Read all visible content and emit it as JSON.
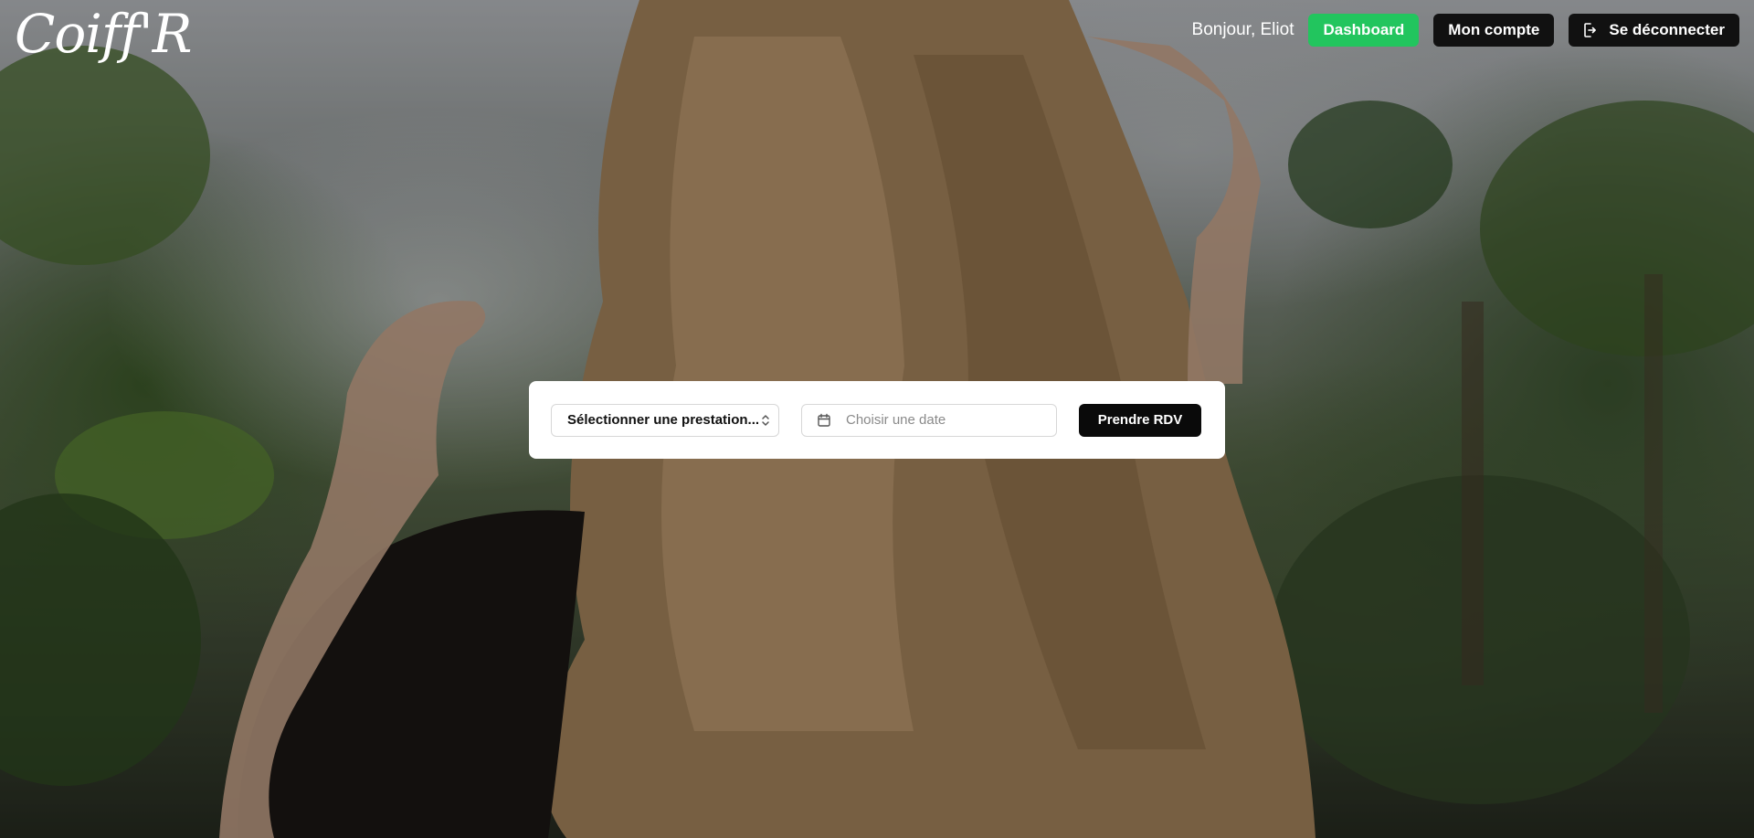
{
  "brand": {
    "logo": "Coiff'R"
  },
  "nav": {
    "greeting": "Bonjour, Eliot",
    "dashboard_label": "Dashboard",
    "account_label": "Mon compte",
    "logout_label": "Se déconnecter",
    "logout_icon": "logout-icon"
  },
  "booking": {
    "service_select": {
      "selected_value": "Sélectionner une prestation...",
      "icon": "chevron-up-down-icon"
    },
    "date_field": {
      "value": "",
      "placeholder": "Choisir une date",
      "icon": "calendar-icon"
    },
    "submit_label": "Prendre RDV"
  },
  "colors": {
    "accent_green": "#22c55e",
    "dark_button": "#0a0a0a",
    "card_background": "#ffffff"
  }
}
